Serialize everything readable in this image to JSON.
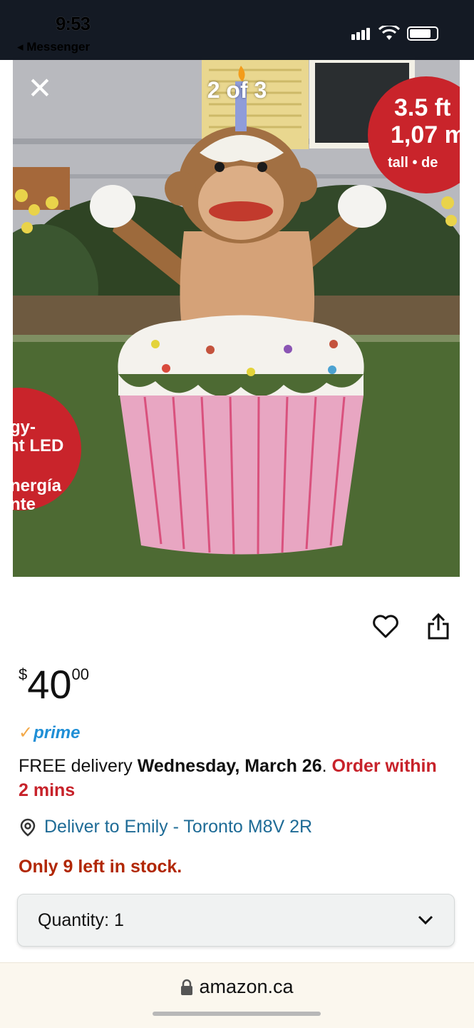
{
  "status_bar": {
    "time": "9:53",
    "back_app": "◂ Messenger",
    "icons": [
      "signal-icon",
      "wifi-icon",
      "battery-icon"
    ]
  },
  "viewer": {
    "counter": "2 of 3",
    "close_icon": "close-icon",
    "box_badge_right": [
      "3.5 ft",
      "1,07 m",
      "tall • de"
    ],
    "box_badge_left": [
      "gy-",
      "nt LED",
      "nergía",
      "nte"
    ]
  },
  "actions": {
    "favorite_icon": "heart-icon",
    "share_icon": "share-icon"
  },
  "price": {
    "currency": "$",
    "whole": "40",
    "fraction": "00"
  },
  "prime": {
    "check": "✓",
    "label": "prime"
  },
  "delivery": {
    "prefix": "FREE delivery ",
    "date": "Wednesday, March 26",
    "sep": ". ",
    "urgency": "Order within 2 mins"
  },
  "deliver_to": {
    "icon": "location-pin-icon",
    "text": "Deliver to Emily - Toronto M8V 2R"
  },
  "stock": "Only 9 left in stock.",
  "quantity": {
    "label": "Quantity:",
    "value": "1"
  },
  "browser": {
    "url": "amazon.ca"
  },
  "colors": {
    "prime_blue": "#1f8fd6",
    "urgency_red": "#c7222a",
    "stock_red": "#b12704",
    "link_blue": "#1e6b96"
  }
}
